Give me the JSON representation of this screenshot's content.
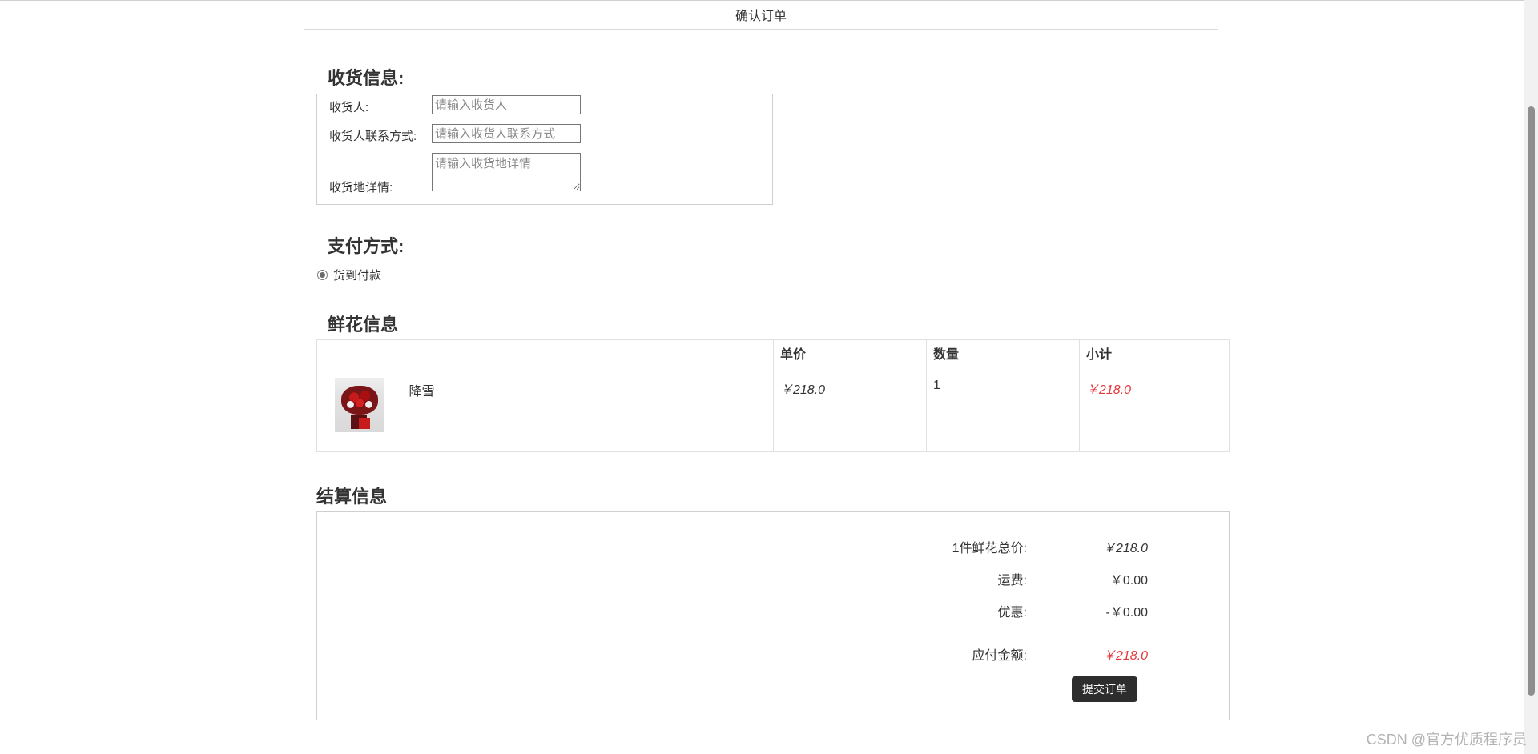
{
  "page": {
    "title": "确认订单"
  },
  "receiver": {
    "heading": "收货信息:",
    "name_label": "收货人:",
    "name_placeholder": "请输入收货人",
    "phone_label": "收货人联系方式:",
    "phone_placeholder": "请输入收货人联系方式",
    "address_label": "收货地详情:",
    "address_placeholder": "请输入收货地详情"
  },
  "payment": {
    "heading": "支付方式:",
    "option_label": "货到付款",
    "selected": true
  },
  "flowers": {
    "heading": "鲜花信息",
    "columns": [
      "",
      "单价",
      "数量",
      "小计"
    ],
    "rows": [
      {
        "name": "降雪",
        "unit_price": "￥218.0",
        "quantity": "1",
        "subtotal": "￥218.0",
        "image_icon": "flower-bouquet-thumbnail"
      }
    ]
  },
  "settlement": {
    "heading": "结算信息",
    "total_label": "1件鲜花总价:",
    "total_value": "￥218.0",
    "shipping_label": "运费:",
    "shipping_value": "￥0.00",
    "discount_label": "优惠:",
    "discount_value": "-￥0.00",
    "payable_label": "应付金额:",
    "payable_value": "￥218.0",
    "submit_label": "提交订单"
  },
  "watermark": "CSDN @官方优质程序员",
  "colors": {
    "accent_red": "#e4393c",
    "button_dark": "#2d2d2d"
  }
}
